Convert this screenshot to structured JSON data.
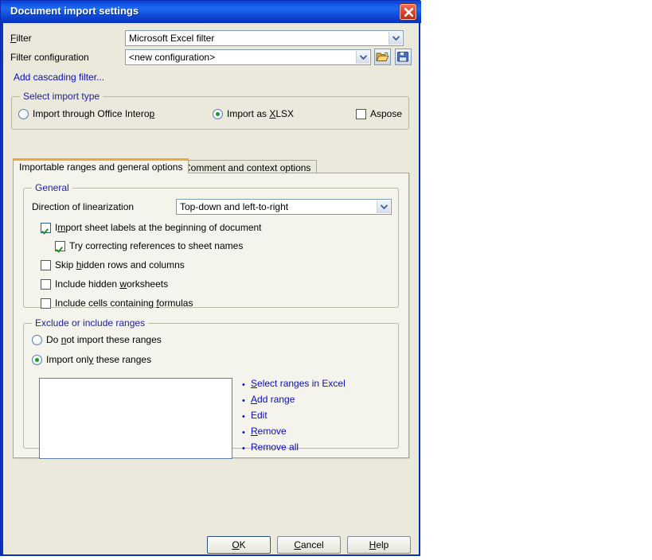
{
  "window": {
    "title": "Document import settings",
    "close_icon": "close-icon"
  },
  "filter_row": {
    "label": "Filter",
    "accel": "F",
    "value": "Microsoft Excel filter"
  },
  "filter_config_row": {
    "label": "Filter configuration",
    "value": "<new configuration>",
    "open_icon": "folder-open-icon",
    "save_icon": "floppy-disk-save-icon"
  },
  "cascading_link": "Add cascading filter...",
  "import_type": {
    "caption": "Select import type",
    "options": [
      {
        "label": "Import through Office Interop",
        "selected": false
      },
      {
        "label": "Import as XLSX",
        "selected": true
      }
    ],
    "aspose": {
      "label": "Aspose",
      "checked": false
    }
  },
  "tabs": [
    {
      "label": "Importable ranges and general options",
      "active": true
    },
    {
      "label": "Comment and context options",
      "active": false
    }
  ],
  "general": {
    "caption": "General",
    "direction_label": "Direction of linearization",
    "direction_value": "Top-down and left-to-right",
    "checkboxes": [
      {
        "label": "Import sheet labels at the beginning of document",
        "checked": true,
        "indent": 0
      },
      {
        "label": "Try correcting references to sheet names",
        "checked": true,
        "indent": 1
      },
      {
        "label": "Skip hidden rows and columns",
        "checked": false,
        "indent": 0
      },
      {
        "label": "Include hidden worksheets",
        "checked": false,
        "indent": 0
      },
      {
        "label": "Include cells containing formulas",
        "checked": false,
        "indent": 0
      }
    ]
  },
  "ranges": {
    "caption": "Exclude or include ranges",
    "options": [
      {
        "label": "Do not import these ranges",
        "selected": false
      },
      {
        "label": "Import only these ranges",
        "selected": true
      }
    ],
    "list_items": [],
    "actions": [
      "Select ranges in Excel",
      "Add range",
      "Edit",
      "Remove",
      "Remove all"
    ]
  },
  "footer": {
    "ok": "OK",
    "cancel": "Cancel",
    "help": "Help"
  },
  "colors": {
    "title_bar": "#1457e6",
    "dialog_face": "#eae9dc",
    "panel_face": "#f4f3ec",
    "group_caption": "#20209a",
    "link": "#0d0db3",
    "active_tab_accent": "#f0a73a",
    "field_border": "#7f9db9",
    "check_green": "#1e8c27"
  }
}
